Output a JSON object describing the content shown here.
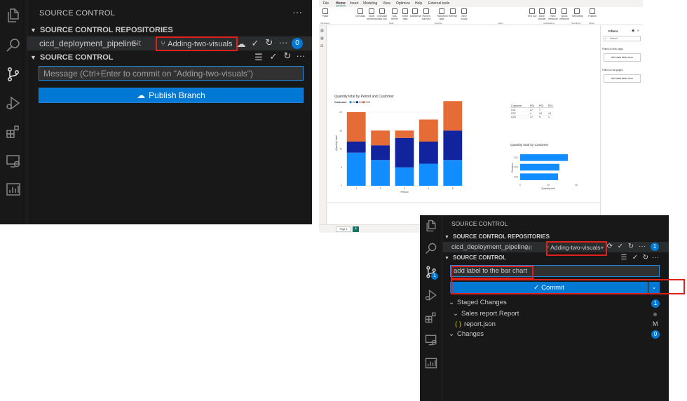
{
  "vs1": {
    "panel_title": "SOURCE CONTROL",
    "more": "···",
    "repos_header": "SOURCE CONTROL REPOSITORIES",
    "repo_name": "cicd_deployment_pipeline",
    "repo_type": "Git",
    "branch": "Adding-two-visuals",
    "repo_badge": "0",
    "sc_header": "SOURCE CONTROL",
    "message_placeholder": "Message (Ctrl+Enter to commit on \"Adding-two-visuals\")",
    "publish_label": "Publish Branch"
  },
  "pbi": {
    "tabs": [
      "File",
      "Home",
      "Insert",
      "Modeling",
      "View",
      "Optimize",
      "Help",
      "External tools"
    ],
    "ribbon_buttons": [
      "Paste",
      "Get data",
      "Excel workbook",
      "OneLake data hub",
      "SQL Server",
      "Enter data",
      "Dataverse",
      "Recent sources",
      "Transform data",
      "Refresh",
      "New visual",
      "Text box",
      "More visuals",
      "New measure",
      "Quick measure",
      "Sensitivity",
      "Publish"
    ],
    "ribbon_groups": [
      "Clipboard",
      "Data",
      "Queries",
      "Insert",
      "Calculations",
      "Sensitivity",
      "Share"
    ],
    "filters_title": "Filters",
    "filters_search": "Search",
    "filters_on_page": "Filters on this page",
    "filters_all_pages": "Filters on all pages",
    "add_data_fields": "Add data fields here",
    "page_tab": "Page 1",
    "bar_chart": {
      "title": "Quantity total by Period and Customer",
      "legend_label": "Customer",
      "ylabel": "Quantity total",
      "xlabel": "Period"
    },
    "table": {
      "headers": [
        "Customer",
        "P01",
        "P02",
        "P03"
      ],
      "rows": [
        [
          "C01",
          "27",
          "7",
          ""
        ],
        [
          "C02",
          "4",
          "10",
          "14"
        ],
        [
          "C03",
          "17",
          "9",
          "1"
        ]
      ]
    },
    "hbar_chart": {
      "title": "Quantity total by Customer",
      "ylabel": "Customer",
      "xlabel": "Quantity total"
    }
  },
  "chart_data": [
    {
      "type": "bar",
      "stacked": true,
      "title": "Quantity total by Period and Customer",
      "xlabel": "Period",
      "ylabel": "Quantity total",
      "categories": [
        "1",
        "2",
        "3",
        "4",
        "5"
      ],
      "series": [
        {
          "name": "C01",
          "color": "#118DFF",
          "values": [
            9,
            7,
            5,
            6,
            7
          ]
        },
        {
          "name": "C02",
          "color": "#12239E",
          "values": [
            3,
            4,
            8,
            6,
            8
          ]
        },
        {
          "name": "C03",
          "color": "#E66C37",
          "values": [
            8,
            4,
            2,
            6,
            8
          ]
        }
      ],
      "ylim": [
        0,
        24
      ],
      "yticks": [
        0,
        5,
        10,
        15,
        20
      ],
      "legend": "top-left"
    },
    {
      "type": "bar",
      "orientation": "horizontal",
      "title": "Quantity total by Customer",
      "xlabel": "Quantity total",
      "ylabel": "Customer",
      "categories": [
        "C01",
        "C02",
        "C03"
      ],
      "values": [
        34,
        28,
        27
      ],
      "xlim": [
        0,
        40
      ],
      "xticks": [
        0,
        20,
        40
      ],
      "color": "#118DFF"
    }
  ],
  "vs2": {
    "panel_title": "SOURCE CONTROL",
    "repos_header": "SOURCE CONTROL REPOSITORIES",
    "repo_name": "cicd_deployment_pipeline",
    "repo_type": "Git",
    "branch": "Adding-two-visuals+",
    "repo_badge": "1",
    "sc_header": "SOURCE CONTROL",
    "commit_message": "add label to the bar chart",
    "commit_label": "Commit",
    "staged_label": "Staged Changes",
    "staged_badge": "1",
    "folder_name": "Sales report.Report",
    "file_icon": "{ }",
    "file_name": "report.json",
    "file_status": "M",
    "changes_label": "Changes",
    "changes_badge": "0",
    "scm_act_badge": "1"
  }
}
